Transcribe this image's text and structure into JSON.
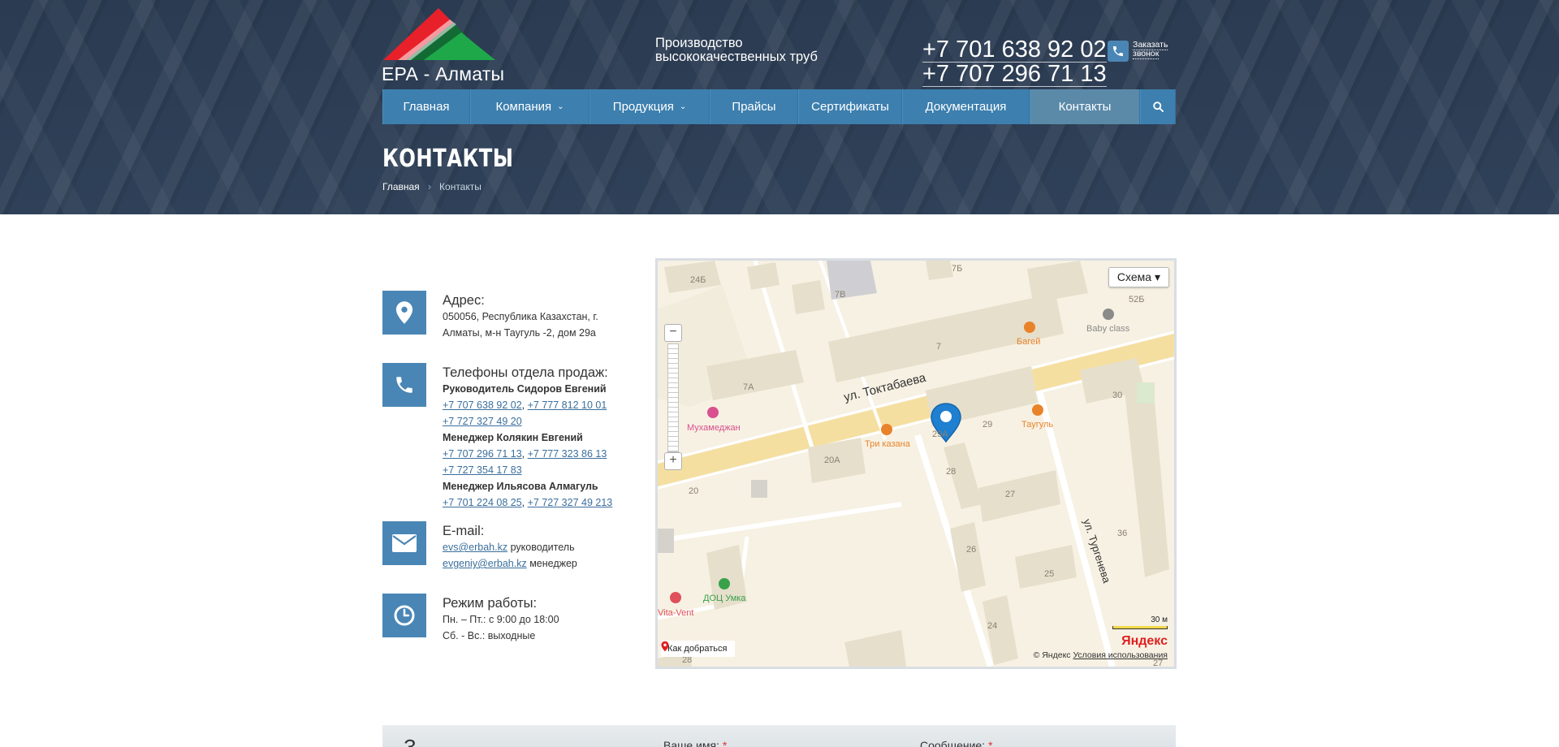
{
  "header": {
    "logo_text": "ЕРА - Алматы",
    "slogan_line1": "Производство",
    "slogan_line2": "высококачественных труб",
    "phones": [
      "+7 701 638 92 02",
      "+7 707 296 71 13"
    ],
    "callback_line1": "Заказать",
    "callback_line2": "звонок",
    "logo_colors": {
      "red": "#e8202a",
      "green": "#1fa84a",
      "dark_green": "#136b34"
    }
  },
  "nav": {
    "items": [
      {
        "label": "Главная",
        "dropdown": false
      },
      {
        "label": "Компания",
        "dropdown": true
      },
      {
        "label": "Продукция",
        "dropdown": true
      },
      {
        "label": "Прайсы",
        "dropdown": false
      },
      {
        "label": "Сертификаты",
        "dropdown": false
      },
      {
        "label": "Документация",
        "dropdown": false
      },
      {
        "label": "Контакты",
        "dropdown": false,
        "active": true
      }
    ],
    "search_icon": "search-icon",
    "accent": "#3d7fae"
  },
  "page": {
    "title": "КОНТАКТЫ",
    "breadcrumb": [
      "Главная",
      "Контакты"
    ]
  },
  "contacts": {
    "address": {
      "title": "Адрес:",
      "line1": "050056, Республика Казахстан, г.",
      "line2": "Алматы, м-н Таугуль -2, дом 29а"
    },
    "phones": {
      "title": "Телефоны отдела продаж:",
      "groups": [
        {
          "name": "Руководитель Сидоров Евгений",
          "numbers": [
            "+7 707 638 92 02",
            "+7 777 812 10 01",
            "+7 727 327 49 20"
          ]
        },
        {
          "name": "Менеджер Колякин Евгений",
          "numbers": [
            "+7 707 296 71 13",
            "+7 777 323 86 13",
            "+7 727 354 17 83"
          ]
        },
        {
          "name": "Менеджер Ильясова Алмагуль",
          "numbers": [
            "+7 701 224 08 25",
            "+7 727 327 49 213"
          ]
        }
      ]
    },
    "email": {
      "title": "E-mail:",
      "items": [
        {
          "address": "evs@erbah.kz",
          "role": "руководитель"
        },
        {
          "address": "evgeniy@erbah.kz",
          "role": "менеджер"
        }
      ]
    },
    "hours": {
      "title": "Режим работы:",
      "line1": "Пн. – Пт.: с 9:00 до 18:00",
      "line2": "Сб. - Вс.: выходные"
    }
  },
  "map": {
    "schema_label": "Схема ▾",
    "route_label": "Как добраться",
    "copyright_prefix": "© Яндекс",
    "terms_label": "Условия использования",
    "scale_label": "30 м",
    "brand": "Яндекс",
    "streets": [
      "ул. Токтабаева",
      "ул. Тургенева"
    ],
    "buildings": [
      "24Б",
      "7Б",
      "7В",
      "52Б",
      "7",
      "7А",
      "30",
      "29",
      "29А",
      "20А",
      "28",
      "20",
      "27",
      "36",
      "26",
      "25",
      "24",
      "28",
      "27"
    ],
    "pois": [
      {
        "name": "Baby class",
        "color": "#8a8a8a"
      },
      {
        "name": "Багей",
        "color": "#e8832a"
      },
      {
        "name": "Мухамеджан",
        "color": "#d94f8f"
      },
      {
        "name": "Три казана",
        "color": "#e8832a"
      },
      {
        "name": "Таугуль",
        "color": "#e8832a"
      },
      {
        "name": "ДОЦ Умка",
        "color": "#3aa14a"
      },
      {
        "name": "Vita-Vent",
        "color": "#e0505a"
      }
    ]
  },
  "form": {
    "heading": "З",
    "name_label": "Ваше имя:",
    "message_label": "Сообщение:",
    "required_mark": "*"
  }
}
